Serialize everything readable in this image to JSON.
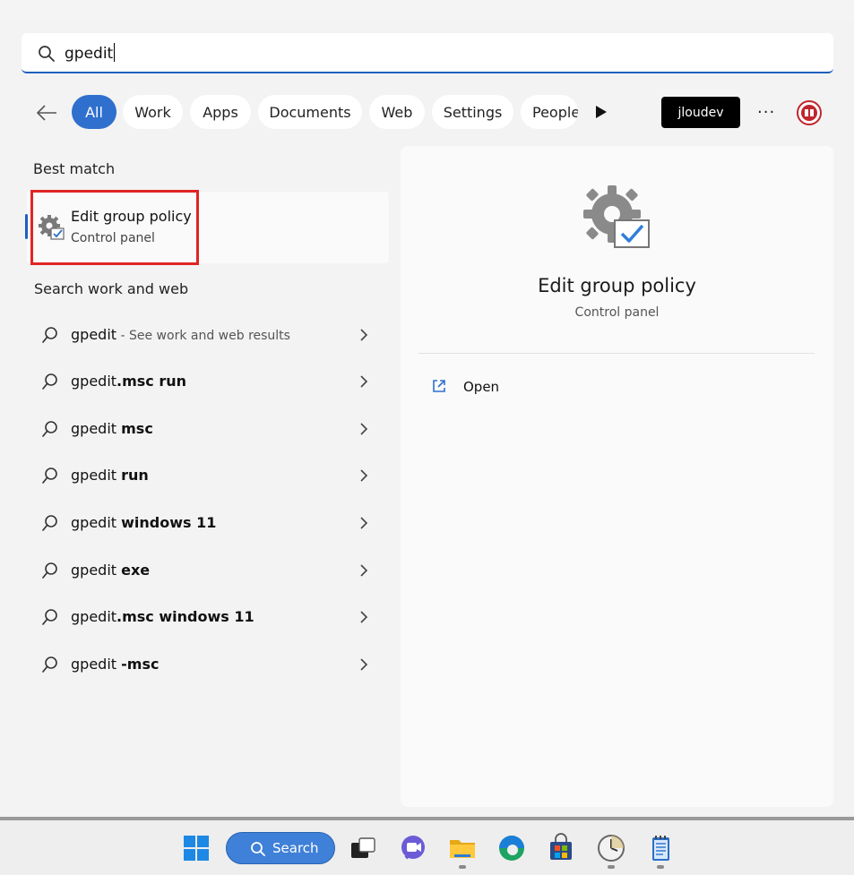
{
  "search": {
    "query": "gpedit",
    "icon": "search-icon"
  },
  "filters": {
    "chips": [
      "All",
      "Work",
      "Apps",
      "Documents",
      "Web",
      "Settings",
      "People"
    ],
    "active": "All",
    "user": "jloudev",
    "more": "···"
  },
  "best_match": {
    "heading": "Best match",
    "title": "Edit group policy",
    "subtitle": "Control panel",
    "icon": "gear-checkbox-icon"
  },
  "search_web": {
    "heading": "Search work and web",
    "items": [
      {
        "pre": "gpedit",
        "bold": "",
        "sub": " - See work and web results"
      },
      {
        "pre": "gpedit",
        "bold": ".msc run",
        "sub": ""
      },
      {
        "pre": "gpedit ",
        "bold": "msc",
        "sub": ""
      },
      {
        "pre": "gpedit ",
        "bold": "run",
        "sub": ""
      },
      {
        "pre": "gpedit ",
        "bold": "windows 11",
        "sub": ""
      },
      {
        "pre": "gpedit ",
        "bold": "exe",
        "sub": ""
      },
      {
        "pre": "gpedit",
        "bold": ".msc windows 11",
        "sub": ""
      },
      {
        "pre": "gpedit ",
        "bold": "-msc",
        "sub": ""
      }
    ]
  },
  "detail": {
    "title": "Edit group policy",
    "subtitle": "Control panel",
    "action_open": "Open"
  },
  "taskbar": {
    "search_label": "Search",
    "apps": [
      "windows-start-icon",
      "task-view-icon",
      "chat-icon",
      "file-explorer-icon",
      "edge-icon",
      "store-icon",
      "clock-icon",
      "notepad-icon"
    ]
  },
  "colors": {
    "accent": "#2f6fce",
    "highlight": "#e12424"
  }
}
